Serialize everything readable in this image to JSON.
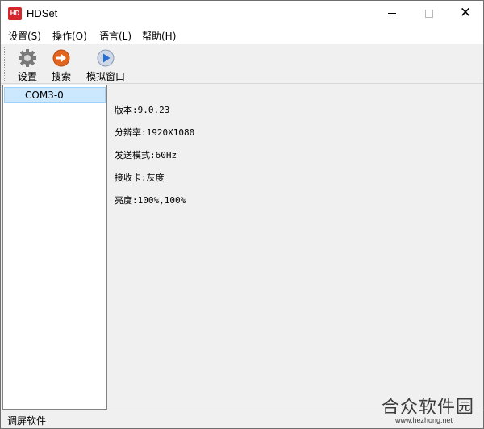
{
  "window": {
    "title": "HDSet",
    "icon_text": "HD",
    "brand_color": "#d3272b"
  },
  "menu": [
    "设置(S)",
    "操作(O)",
    "语言(L)",
    "帮助(H)"
  ],
  "toolbar": {
    "settings_label": "设置",
    "search_label": "搜索",
    "simulate_label": "模拟窗口"
  },
  "tree": {
    "items": [
      "COM3-0"
    ],
    "selected_color": "#cce8ff"
  },
  "info": {
    "version": "版本:9.0.23",
    "resolution": "分辨率:1920X1080",
    "send_mode": "发送模式:60Hz",
    "receiver": "接收卡:灰度",
    "brightness": "亮度:100%,100%"
  },
  "status": {
    "text": "调屏软件"
  },
  "watermark": {
    "title": "合众软件园",
    "url": "www.hezhong.net"
  }
}
